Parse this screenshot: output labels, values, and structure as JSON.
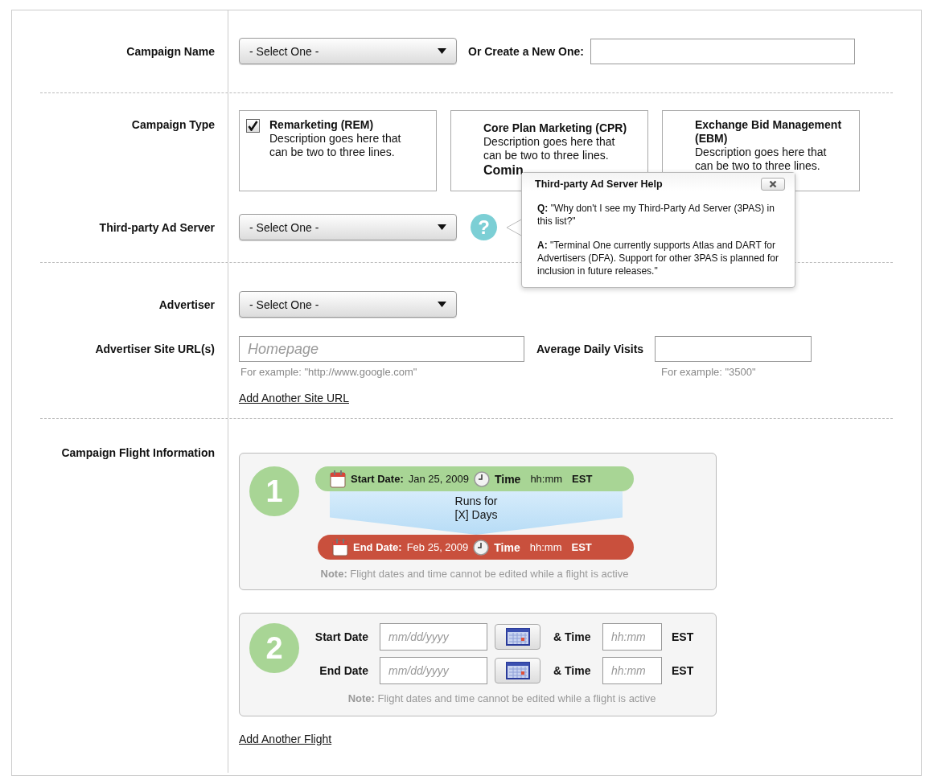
{
  "campaign_name": {
    "label": "Campaign Name",
    "dropdown": "- Select One -",
    "create_label": "Or Create a New One:"
  },
  "campaign_type": {
    "label": "Campaign Type",
    "options": [
      {
        "title": "Remarketing (REM)",
        "description": "Description goes here that can be two to three lines.",
        "checked": true
      },
      {
        "title": "Core Plan Marketing (CPR)",
        "description": "Description goes here that can be two to three lines.",
        "note": "Comin",
        "checked": false
      },
      {
        "title": "Exchange Bid Management (EBM)",
        "description": "Description goes here that can be two to three lines.",
        "checked": false
      }
    ]
  },
  "third_party_ad_server": {
    "label": "Third-party Ad Server",
    "dropdown": "- Select One -",
    "help_icon": "?",
    "help": {
      "title": "Third-party Ad Server Help",
      "question": "**Q:** \"Why don't I see my Third-Party Ad Server (3PAS) in this list?\"",
      "answer": "**A:** \"Terminal One currently supports Atlas and DART for Advertisers (DFA). Support for other 3PAS is planned for inclusion in future releases.\""
    }
  },
  "advertiser": {
    "label": "Advertiser",
    "dropdown": "- Select One -"
  },
  "site": {
    "label": "Advertiser Site URL(s)",
    "placeholder": "Homepage",
    "hint": "For example: \"http://www.google.com\"",
    "visits_label": "Average Daily Visits",
    "visits_hint": "For example: \"3500\"",
    "add_link": "Add Another Site URL"
  },
  "flight": {
    "label": "Campaign Flight Information",
    "flights": [
      {
        "kind": "active",
        "number": "1",
        "start": {
          "label": "Start Date:",
          "date": "Jan 25, 2009",
          "time_label": "Time",
          "time": "hh:mm",
          "zone": "EST"
        },
        "duration": "Runs for [X] Days",
        "end": {
          "label": "End Date:",
          "date": "Feb 25, 2009",
          "time_label": "Time",
          "time": "hh:mm",
          "zone": "EST"
        },
        "note": "**Note:** Flight dates and time cannot be edited while a flight is active"
      },
      {
        "kind": "editable",
        "number": "2",
        "rows": [
          {
            "label": "Start Date",
            "placeholder": "mm/dd/yyyy",
            "time_label": "& Time",
            "time_placeholder": "hh:mm",
            "zone": "EST"
          },
          {
            "label": "End Date",
            "placeholder": "mm/dd/yyyy",
            "time_label": "& Time",
            "time_placeholder": "hh:mm",
            "zone": "EST"
          }
        ],
        "note": "**Note:** Flight dates and time cannot be edited while a flight is active"
      }
    ],
    "add_link": "Add Another Flight"
  }
}
